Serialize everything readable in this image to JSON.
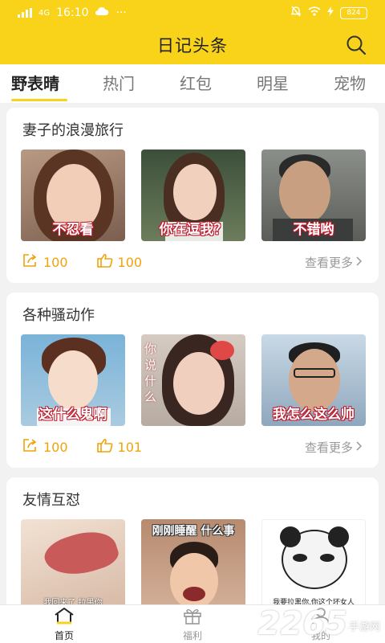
{
  "status_bar": {
    "carrier": "4G",
    "time": "16:10",
    "battery": "824"
  },
  "header": {
    "title": "日记头条",
    "accent_color": "#f8d31a"
  },
  "tabs": [
    {
      "label": "野表晴",
      "active": true
    },
    {
      "label": "热门",
      "active": false
    },
    {
      "label": "红包",
      "active": false
    },
    {
      "label": "明星",
      "active": false
    },
    {
      "label": "宠物",
      "active": false
    }
  ],
  "cards": [
    {
      "title": "妻子的浪漫旅行",
      "captions": [
        "不忍看",
        "你在逗我？",
        "不错哟"
      ],
      "shares": "100",
      "likes": "100",
      "more_label": "查看更多"
    },
    {
      "title": "各种骚动作",
      "captions": [
        "这什么鬼啊",
        "你说什么",
        "我怎么这么帅"
      ],
      "shares": "100",
      "likes": "101",
      "more_label": "查看更多"
    },
    {
      "title": "友情互怼",
      "captions": [
        "我回来了 拉黑你",
        "刚刚睡醒 什么事",
        "我要拉黑你,你这个坏女人"
      ]
    }
  ],
  "bottom_nav": [
    {
      "label": "首页",
      "icon": "home-icon",
      "active": true
    },
    {
      "label": "福利",
      "icon": "gift-icon",
      "active": false
    },
    {
      "label": "我的",
      "icon": "user-icon",
      "active": false
    }
  ],
  "watermark": {
    "big": "2265",
    "small": "手游网"
  }
}
